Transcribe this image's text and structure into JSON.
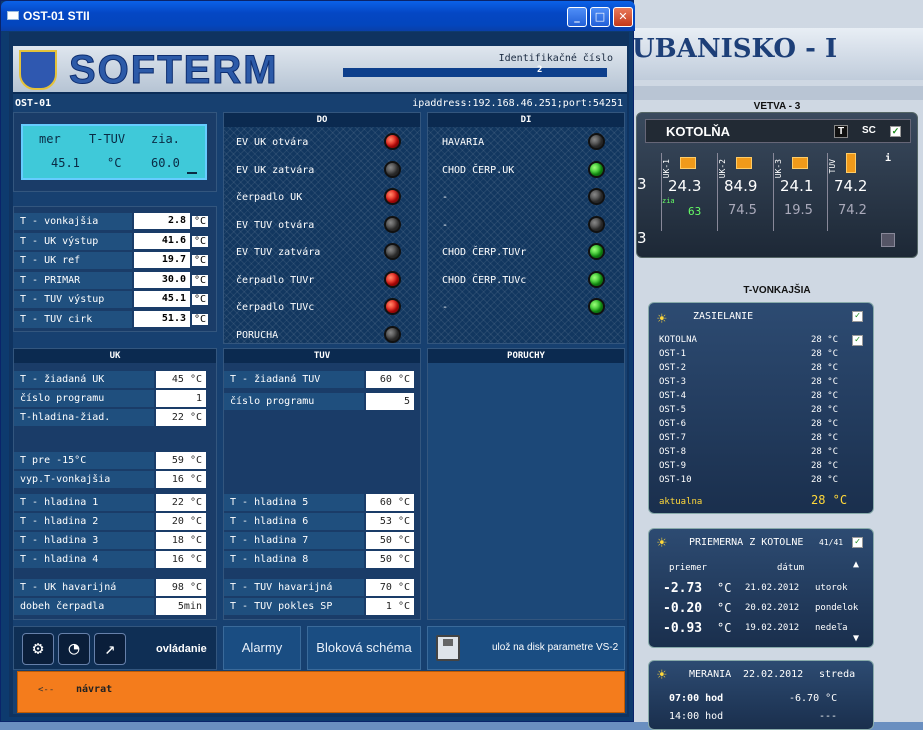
{
  "window": {
    "title": "OST-01 STII",
    "minimize": "_",
    "maximize": "□",
    "close": "✕"
  },
  "background": {
    "header_title": "UBANISKO - I",
    "vetva_caption": "VETVA - 3",
    "kotolna_label": "KOTOLŇA",
    "kotolna_t": "T",
    "kotolna_sc": "SC",
    "gauges": [
      {
        "label": "UK-1",
        "value": "24.3",
        "sub": "63"
      },
      {
        "label": "UK-2",
        "value": "84.9",
        "sub": "74.5"
      },
      {
        "label": "UK-3",
        "value": "24.1",
        "sub": "19.5"
      },
      {
        "label": "TUV",
        "value": "74.2",
        "sub": "74.2"
      }
    ],
    "left_partial": [
      "3",
      "3"
    ],
    "zia_label": "zia",
    "tvonk_caption": "T-VONKAJŠIA",
    "zasielanie": {
      "title": "ZASIELANIE",
      "rows": [
        {
          "name": "KOTOLNA",
          "value": "28 °C"
        },
        {
          "name": "OST-1",
          "value": "28 °C"
        },
        {
          "name": "OST-2",
          "value": "28 °C"
        },
        {
          "name": "OST-3",
          "value": "28 °C"
        },
        {
          "name": "OST-4",
          "value": "28 °C"
        },
        {
          "name": "OST-5",
          "value": "28 °C"
        },
        {
          "name": "OST-6",
          "value": "28 °C"
        },
        {
          "name": "OST-7",
          "value": "28 °C"
        },
        {
          "name": "OST-8",
          "value": "28 °C"
        },
        {
          "name": "OST-9",
          "value": "28 °C"
        },
        {
          "name": "OST-10",
          "value": "28 °C"
        }
      ],
      "aktualna_label": "aktualna",
      "aktualna_value": "28 °C"
    },
    "priemerna": {
      "title": "PRIEMERNA Z KOTOLNE",
      "counter": "41/41",
      "col_priemer": "priemer",
      "col_datum": "dátum",
      "rows": [
        {
          "temp": "-2.73",
          "unit": "°C",
          "date": "21.02.2012",
          "day": "utorok"
        },
        {
          "temp": "-0.20",
          "unit": "°C",
          "date": "20.02.2012",
          "day": "pondelok"
        },
        {
          "temp": "-0.93",
          "unit": "°C",
          "date": "19.02.2012",
          "day": "nedeľa"
        }
      ]
    },
    "merania": {
      "title": "MERANIA",
      "date": "22.02.2012",
      "day": "streda",
      "rows": [
        {
          "time": "07:00 hod",
          "value": "-6.70 °C"
        },
        {
          "time": "14:00 hod",
          "value": "---"
        }
      ]
    }
  },
  "app": {
    "logo_text": "SOFTERM",
    "id_label": "Identifikačné číslo",
    "id_value": "2",
    "device_name": "OST-01",
    "ipaddress": "ipaddress:192.168.46.251;port:54251",
    "lcd": {
      "line1_a": "mer",
      "line1_b": "T-TUV",
      "line1_c": "zia.",
      "line2_a": "45.1",
      "line2_b": "°C",
      "line2_c": "60.0"
    },
    "temps": [
      {
        "label": "T - vonkajšia",
        "value": "2.8",
        "unit": "°C"
      },
      {
        "label": "T - UK výstup",
        "value": "41.6",
        "unit": "°C"
      },
      {
        "label": "T - UK ref",
        "value": "19.7",
        "unit": "°C"
      },
      {
        "label": "T - PRIMAR",
        "value": "30.0",
        "unit": "°C"
      },
      {
        "label": "T - TUV výstup",
        "value": "45.1",
        "unit": "°C"
      },
      {
        "label": "T - TUV cirk",
        "value": "51.3",
        "unit": "°C"
      }
    ],
    "do": {
      "title": "DO",
      "items": [
        {
          "label": "EV UK otvára",
          "state": "red"
        },
        {
          "label": "EV UK zatvára",
          "state": "off"
        },
        {
          "label": "čerpadlo UK",
          "state": "red"
        },
        {
          "label": "EV TUV otvára",
          "state": "off"
        },
        {
          "label": "EV TUV zatvára",
          "state": "off"
        },
        {
          "label": "čerpadlo TUVr",
          "state": "red"
        },
        {
          "label": "čerpadlo TUVc",
          "state": "red"
        },
        {
          "label": "PORUCHA",
          "state": "off"
        }
      ]
    },
    "di": {
      "title": "DI",
      "items": [
        {
          "label": "HAVARIA",
          "state": "off"
        },
        {
          "label": "CHOD ČERP.UK",
          "state": "green"
        },
        {
          "label": "-",
          "state": "off"
        },
        {
          "label": "-",
          "state": "off"
        },
        {
          "label": "CHOD ČERP.TUVr",
          "state": "green"
        },
        {
          "label": "CHOD ČERP.TUVc",
          "state": "green"
        },
        {
          "label": "-",
          "state": "green"
        }
      ]
    },
    "uk": {
      "title": "UK",
      "rows": [
        {
          "label": "T - žiadaná UK",
          "value": "45 °C"
        },
        {
          "label": "číslo programu",
          "value": "1"
        },
        {
          "label": "T-hladina-žiad.",
          "value": "22 °C"
        },
        {
          "label": "T pre -15°C",
          "value": "59 °C"
        },
        {
          "label": "vyp.T-vonkajšia",
          "value": "16 °C"
        },
        {
          "label": "T - hladina 1",
          "value": "22 °C"
        },
        {
          "label": "T - hladina 2",
          "value": "20 °C"
        },
        {
          "label": "T - hladina 3",
          "value": "18 °C"
        },
        {
          "label": "T - hladina 4",
          "value": "16 °C"
        },
        {
          "label": "T - UK havarijná",
          "value": "98 °C"
        },
        {
          "label": "dobeh čerpadla",
          "value": "5min"
        }
      ]
    },
    "tuv": {
      "title": "TUV",
      "rows": [
        {
          "label": "T - žiadaná TUV",
          "value": "60 °C"
        },
        {
          "label": "číslo programu",
          "value": "5"
        },
        {
          "label": "T - hladina 5",
          "value": "60 °C"
        },
        {
          "label": "T - hladina 6",
          "value": "53 °C"
        },
        {
          "label": "T - hladina 7",
          "value": "50 °C"
        },
        {
          "label": "T - hladina 8",
          "value": "50 °C"
        },
        {
          "label": "T - TUV havarijná",
          "value": "70 °C"
        },
        {
          "label": "T - TUV pokles SP",
          "value": "1 °C"
        }
      ]
    },
    "poruchy": {
      "title": "PORUCHY"
    },
    "toolbar": {
      "ovladanie": "ovládanie",
      "alarmy": "Alarmy",
      "blokova": "Bloková schéma",
      "uloz": "ulož na disk parametre VS-2"
    },
    "navrat": {
      "arrow": "<--",
      "label": "návrat"
    }
  }
}
